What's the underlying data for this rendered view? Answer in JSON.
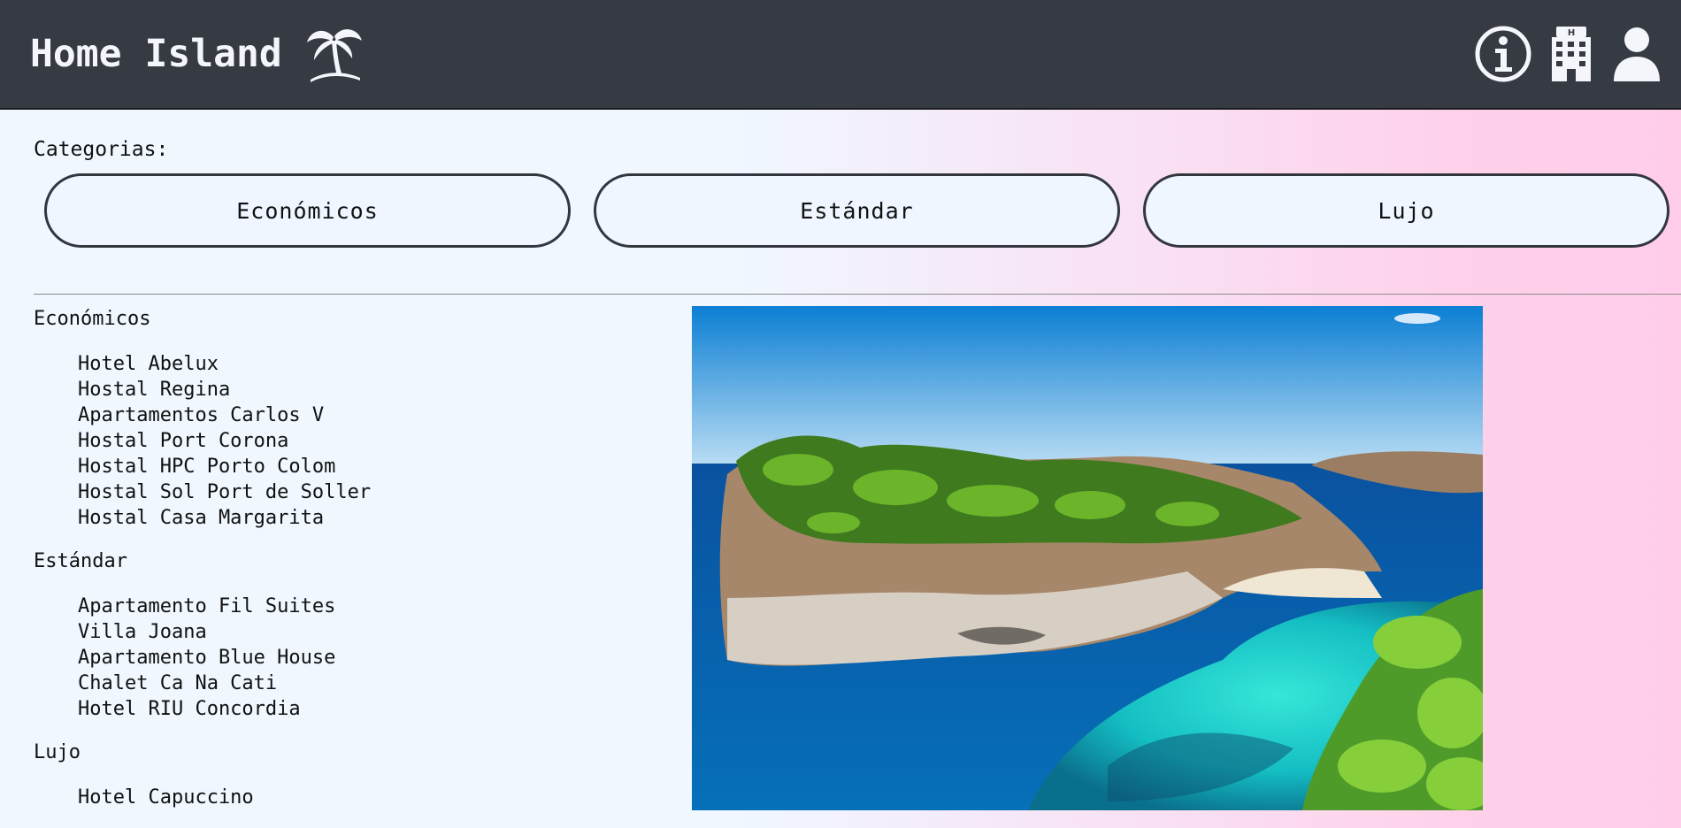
{
  "header": {
    "title": "Home Island"
  },
  "icons": {
    "brand": "palm-tree-icon",
    "info": "info-icon",
    "hotel": "hotel-building-icon",
    "user": "user-icon"
  },
  "categories": {
    "label": "Categorias:",
    "buttons": [
      "Económicos",
      "Estándar",
      "Lujo"
    ]
  },
  "sections": [
    {
      "title": "Económicos",
      "items": [
        "Hotel Abelux",
        "Hostal Regina",
        "Apartamentos Carlos V",
        "Hostal Port Corona",
        "Hostal HPC Porto Colom",
        "Hostal Sol Port de Soller",
        "Hostal Casa Margarita"
      ]
    },
    {
      "title": "Estándar",
      "items": [
        "Apartamento Fil Suites",
        "Villa Joana",
        "Apartamento Blue House",
        "Chalet Ca Na Cati",
        "Hotel RIU Concordia"
      ]
    },
    {
      "title": "Lujo",
      "items": [
        "Hotel Capuccino"
      ]
    }
  ],
  "colors": {
    "header_bg": "#363a43",
    "page_left": "#f0f7ff",
    "page_right": "#ffcdea"
  }
}
